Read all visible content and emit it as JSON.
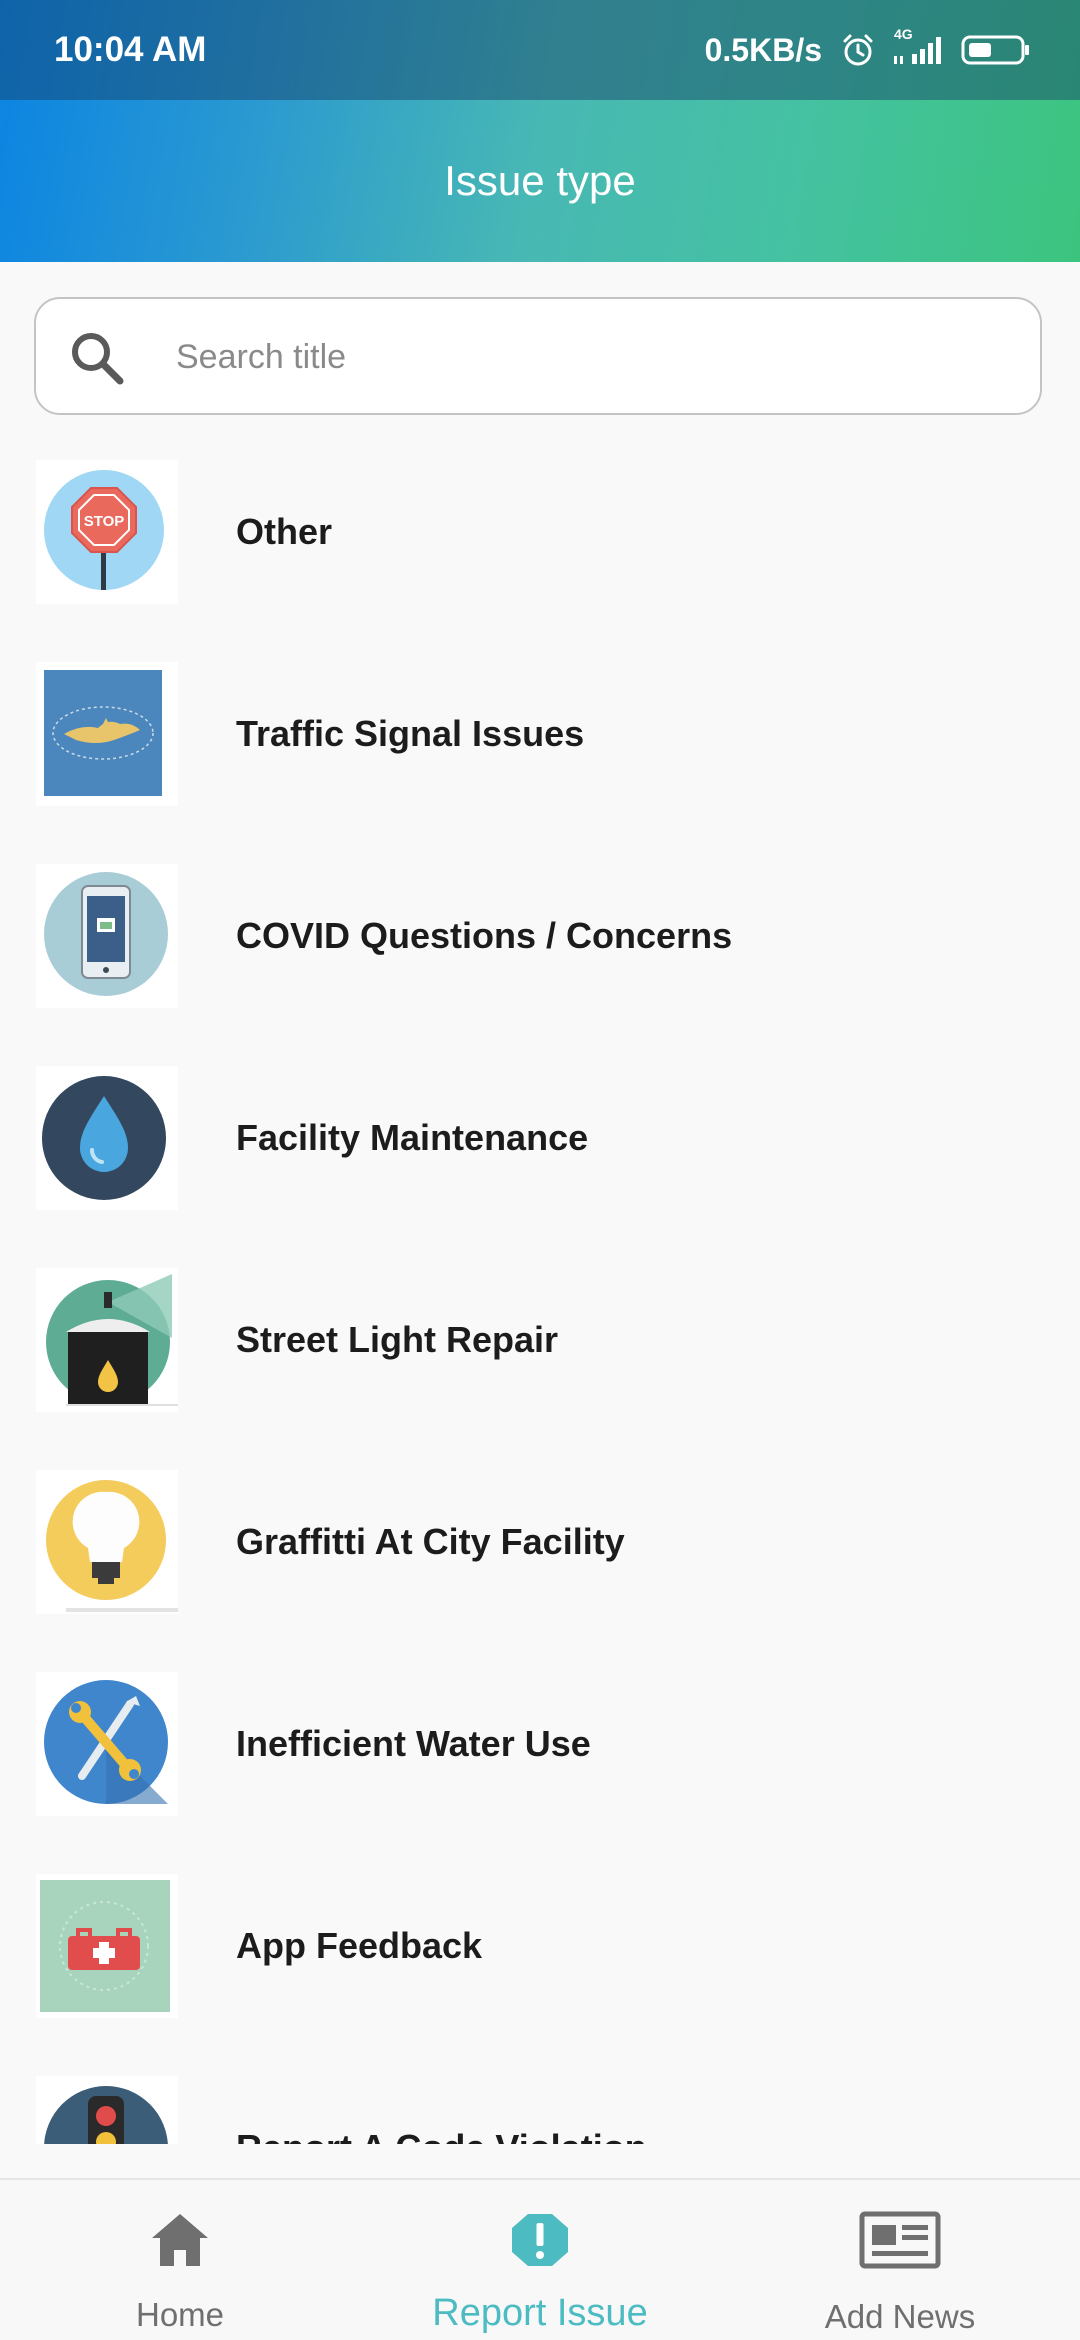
{
  "status_bar": {
    "time": "10:04 AM",
    "speed": "0.5KB/s",
    "network": "4G",
    "icons": [
      "alarm-icon",
      "signal-icon",
      "battery-icon"
    ]
  },
  "header": {
    "title": "Issue type"
  },
  "search": {
    "placeholder": "Search title",
    "value": ""
  },
  "issue_types": [
    {
      "label": "Other",
      "icon": "stop-sign-icon"
    },
    {
      "label": "Traffic Signal Issues",
      "icon": "map-seal-icon"
    },
    {
      "label": "COVID Questions / Concerns",
      "icon": "smartphone-icon"
    },
    {
      "label": "Facility Maintenance",
      "icon": "water-drop-icon"
    },
    {
      "label": "Street Light Repair",
      "icon": "street-light-icon"
    },
    {
      "label": "Graffitti At City Facility",
      "icon": "light-bulb-icon"
    },
    {
      "label": "Inefficient Water Use",
      "icon": "tools-icon"
    },
    {
      "label": "App Feedback",
      "icon": "first-aid-kit-icon"
    },
    {
      "label": "Report A Code Violation",
      "icon": "traffic-light-icon"
    }
  ],
  "bottom_nav": {
    "active_color": "#4dbbc2",
    "inactive_color": "#6f6f6f",
    "items": [
      {
        "label": "Home",
        "icon": "home-icon",
        "active": false
      },
      {
        "label": "Report Issue",
        "icon": "alert-icon",
        "active": true
      },
      {
        "label": "Add News",
        "icon": "newspaper-icon",
        "active": false
      }
    ]
  }
}
